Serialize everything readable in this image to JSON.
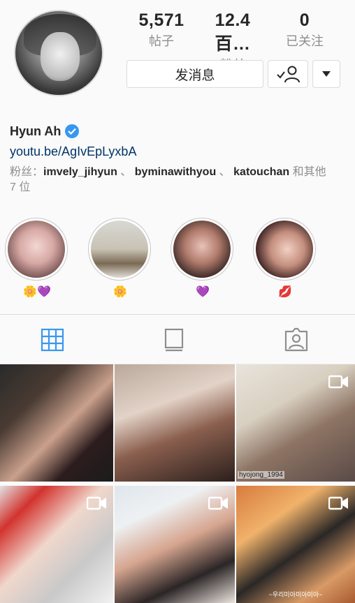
{
  "profile": {
    "username": "Hyun Ah",
    "link": "youtu.be/AgIvEpLyxbA",
    "stats": [
      {
        "value": "5,571",
        "label": "帖子"
      },
      {
        "value": "12.4百…",
        "label": "粉丝"
      },
      {
        "value": "0",
        "label": "已关注"
      }
    ],
    "message_label": "发消息",
    "followed_by": {
      "prefix": "粉丝：",
      "users": [
        "imvely_jihyun",
        "byminawithyou",
        "katouchan"
      ],
      "separator": "、",
      "suffix": "和其他",
      "suffix2": "7 位"
    }
  },
  "highlights": [
    {
      "emoji": "🌼💜"
    },
    {
      "emoji": "🌼"
    },
    {
      "emoji": "💜"
    },
    {
      "emoji": "💋"
    }
  ],
  "tabs": [
    "grid-icon",
    "feed-icon",
    "tagged-icon"
  ],
  "posts": [
    {
      "tag": "",
      "caption": ""
    },
    {
      "tag": "",
      "caption": ""
    },
    {
      "tag": "hyojong_1994",
      "caption": ""
    },
    {
      "tag": "",
      "caption": ""
    },
    {
      "tag": "",
      "caption": ""
    },
    {
      "tag": "",
      "caption": "~우리미아미아미아~"
    }
  ],
  "colors": {
    "accent": "#3897f0",
    "link": "#003569",
    "secondary_text": "#8e8e8e",
    "border": "#dbdbdb"
  }
}
